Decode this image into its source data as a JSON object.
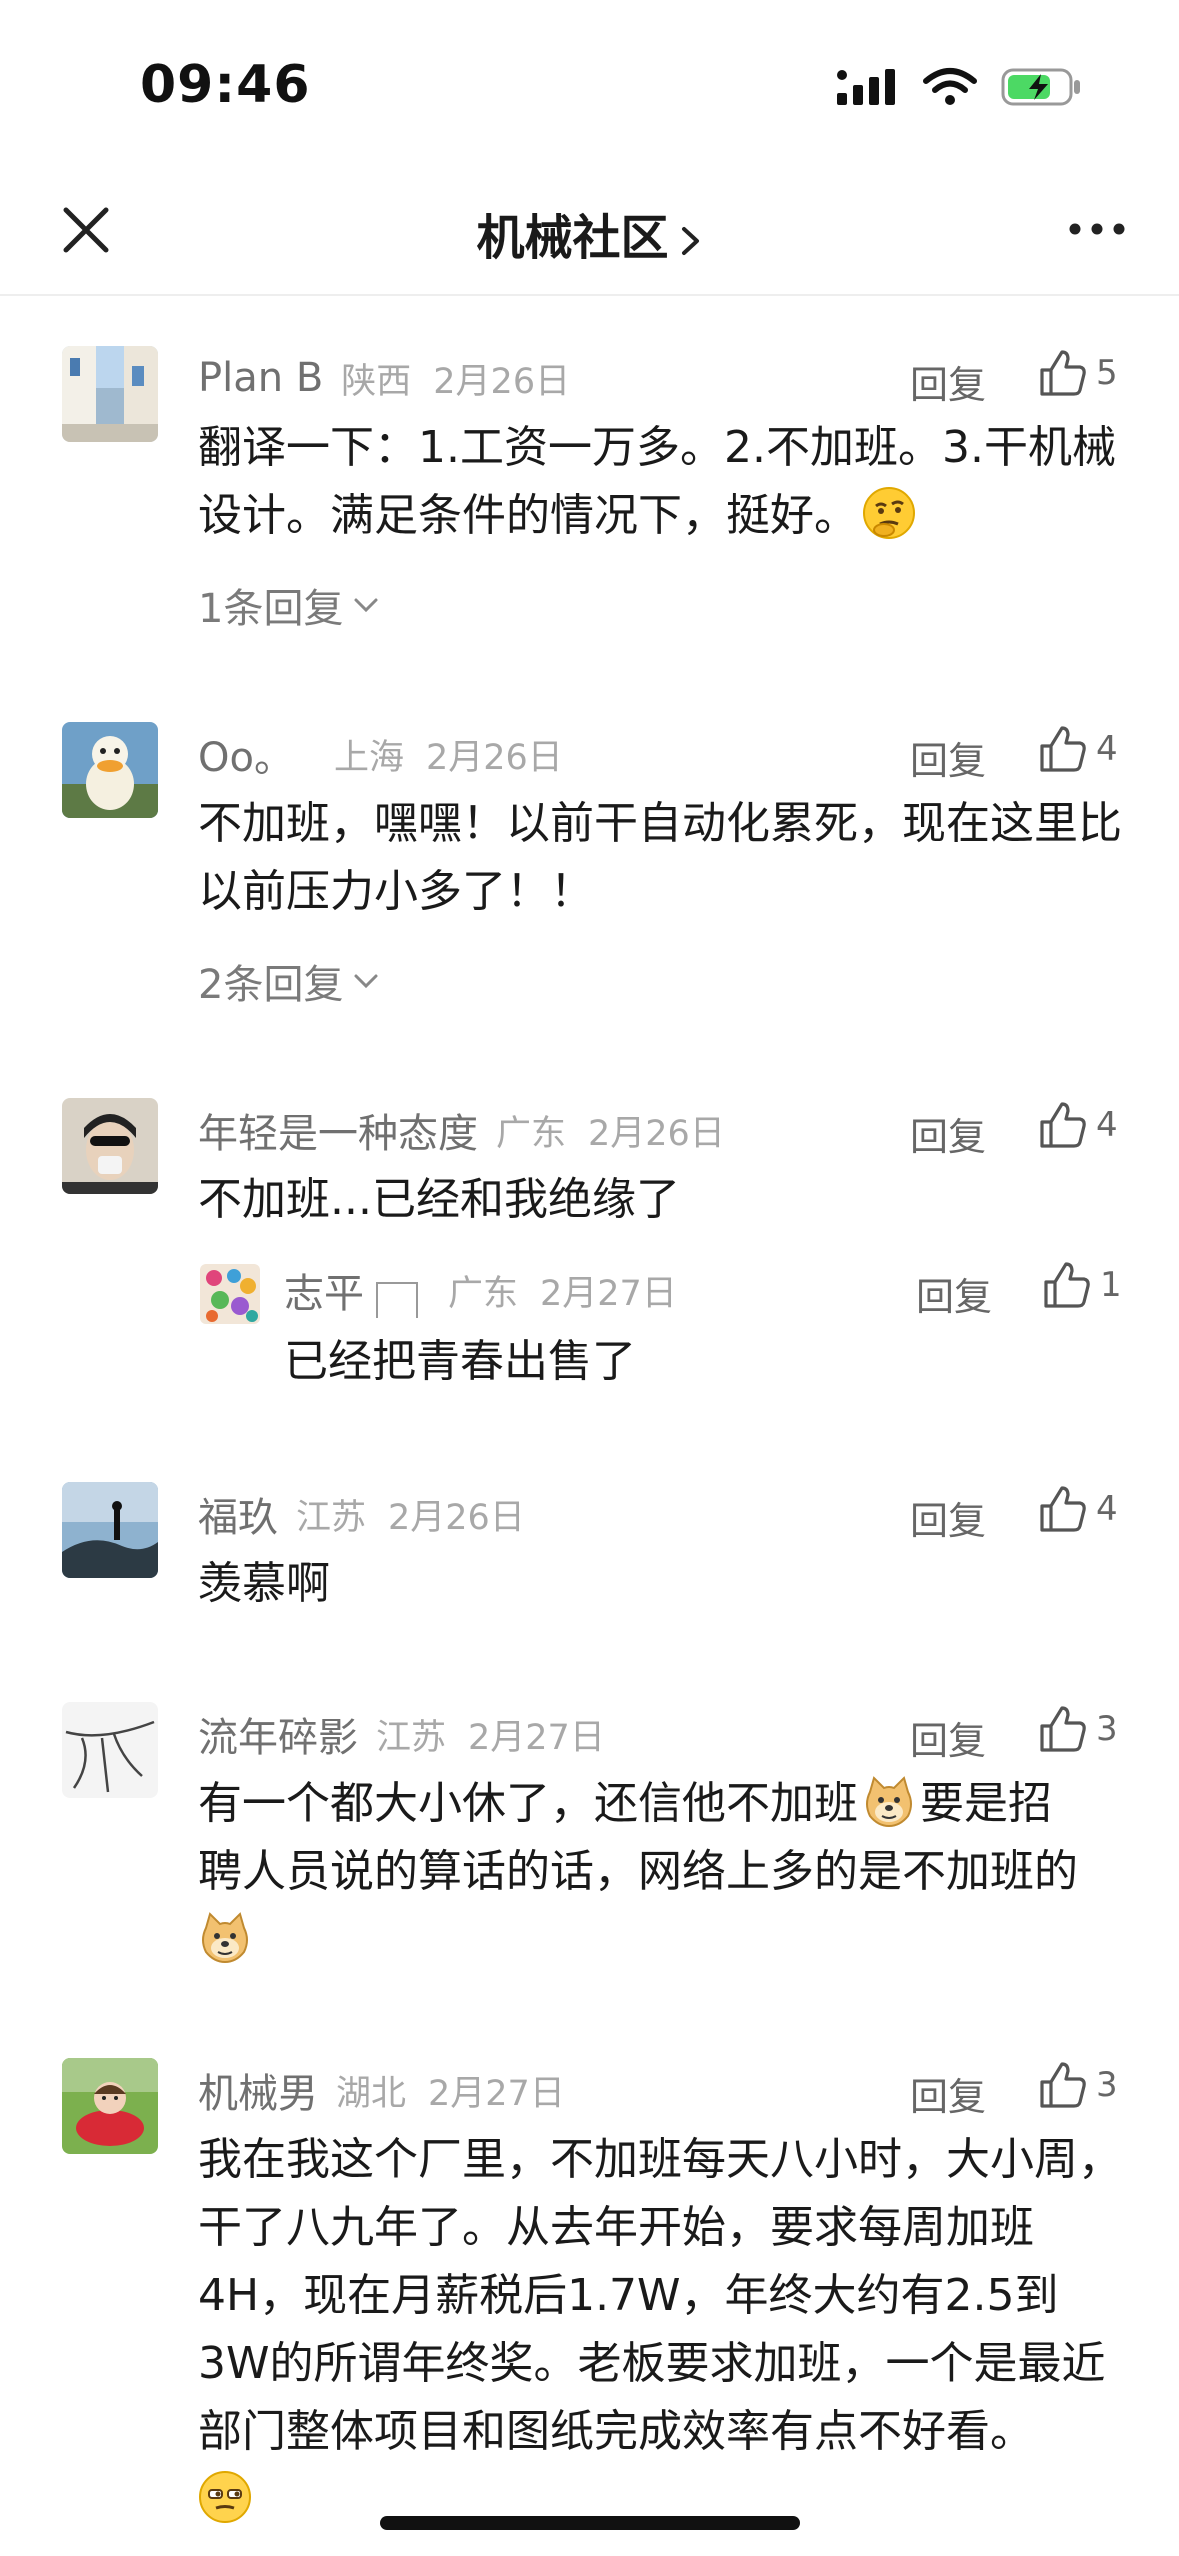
{
  "status_bar": {
    "time": "09:46"
  },
  "nav": {
    "title": "机械社区",
    "close_icon": "close-icon",
    "more_icon": "more-icon"
  },
  "comments": [
    {
      "user": "Plan B",
      "location": "陕西",
      "date": "2月26日",
      "reply_label": "回复",
      "likes": "5",
      "text": "翻译一下：1.工资一万多。2.不加班。3.干机械设计。满足条件的情况下，挺好。",
      "replies_label": "1条回复"
    },
    {
      "user": "Oo。",
      "location": "上海",
      "date": "2月26日",
      "reply_label": "回复",
      "likes": "4",
      "text": "不加班，嘿嘿！以前干自动化累死，现在这里比以前压力小多了！！",
      "replies_label": "2条回复"
    },
    {
      "user": "年轻是一种态度",
      "location": "广东",
      "date": "2月26日",
      "reply_label": "回复",
      "likes": "4",
      "text": "不加班...已经和我绝缘了",
      "sub_reply": {
        "user": "志平",
        "location": "广东",
        "date": "2月27日",
        "reply_label": "回复",
        "likes": "1",
        "text": "已经把青春出售了"
      }
    },
    {
      "user": "福玖",
      "location": "江苏",
      "date": "2月26日",
      "reply_label": "回复",
      "likes": "4",
      "text": "羡慕啊"
    },
    {
      "user": "流年碎影",
      "location": "江苏",
      "date": "2月27日",
      "reply_label": "回复",
      "likes": "3",
      "text_line1_a": "有一个都大小休了，还信他不加班",
      "text_line1_b": "要是招",
      "text_line2": "聘人员说的算话的话，网络上多的是不加班的"
    },
    {
      "user": "机械男",
      "location": "湖北",
      "date": "2月27日",
      "reply_label": "回复",
      "likes": "3",
      "text": "我在我这个厂里，不加班每天八小时，大小周，干了八九年了。从去年开始，要求每周加班4H，现在月薪税后1.7W，年终大约有2.5到3W的所谓年终奖。老板要求加班，一个是最近部门整体项目和图纸完成效率有点不好看。"
    }
  ],
  "colors": {
    "text": "#1a1a1a",
    "meta": "#707070",
    "meta_light": "#a8a8a8",
    "battery_green": "#4cd964"
  }
}
